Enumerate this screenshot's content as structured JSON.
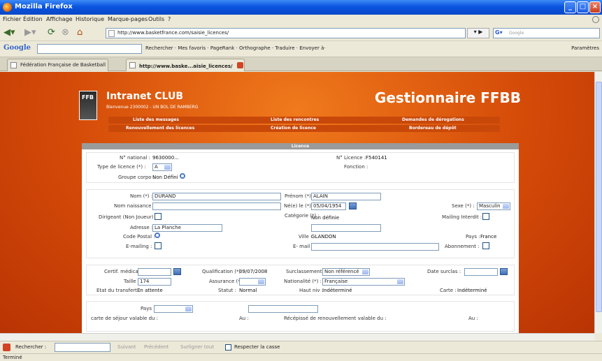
{
  "window": {
    "title": "Mozilla Firefox"
  },
  "menu": [
    "Fichier",
    "Édition",
    "Affichage",
    "Historique",
    "Marque-pages",
    "Outils",
    "?"
  ],
  "nav": {
    "url": "http://www.basketfrance.com/saisie_licences/",
    "search_placeholder": "Google"
  },
  "googlebar": {
    "logo": "Google",
    "tools": "Rechercher · Mes favoris · PageRank · Orthographe · Traduire · Envoyer à·",
    "params": "Paramètres"
  },
  "tabs": [
    {
      "label": "Fédération Française de Basketball"
    },
    {
      "label": "http://www.baske...aisie_licences/"
    }
  ],
  "header": {
    "logo_text": "FFB",
    "club": "Intranet CLUB",
    "welcome": "Bienvenue 2300002 - UN BOL DE RAMBERG",
    "gestionnaire": "Gestionnaire FFBB",
    "nav1": [
      "Liste des messages",
      "Liste des rencontres",
      "Demandes de dérogations"
    ],
    "nav2": [
      "Renouvellement des licences",
      "Création de licence",
      "Bordereau de dépôt"
    ]
  },
  "panel": {
    "strip": "Licence"
  },
  "sec1": {
    "num_national_label": "N° national :",
    "num_national": "9630000...",
    "type_licence_label": "Type de licence (*) :",
    "type_licence": "A",
    "groupe_label": "Groupe corpo :",
    "groupe": "Non Défini",
    "num_licence_label": "N° Licence :",
    "num_licence": "F540141",
    "fonction_label": "Fonction :"
  },
  "sec2": {
    "nom_label": "Nom (*) :",
    "nom": "DURAND",
    "naissance_label": "Nom naissance :",
    "prenom_label": "Prénom (*) :",
    "prenom": "ALAIN",
    "nele_label": "Né(e) le (*) :",
    "nele": "05/04/1954",
    "sexe_label": "Sexe (*) :",
    "sexe": "Masculin",
    "dirigeant_label": "Dirigeant (Non Joueur) :",
    "categorie_label": "Catégorie (*) :",
    "categorie": "Non définie",
    "mailing_label": "Mailing Interdit :",
    "adresse_label": "Adresse :",
    "adresse": "La Planche",
    "cp_label": "Code Postal :",
    "ville_label": "Ville :",
    "ville": "GLANDON",
    "pays_label": "Pays :",
    "pays": "France",
    "emailing_label": "E-mailing :",
    "email_label": "E- mail :",
    "abonnement_label": "Abonnement :"
  },
  "sec3": {
    "certif_label": "Certif. médical :",
    "qualif_label": "Qualification (*) :",
    "qualif": "09/07/2008",
    "surclass_label": "Surclassement :",
    "surclass": "Non référencé",
    "date_surclass_label": "Date surclas :",
    "taille_label": "Taille :",
    "taille": "174",
    "assurance_label": "Assurance (*) :",
    "nationalite_label": "Nationalité (*) :",
    "nationalite": "Française",
    "etat_label": "Etat du transfert :",
    "etat": "En attente",
    "statut_label": "Statut :",
    "statut": "Normal",
    "hautniv_label": "Haut niv :",
    "hautniv": "Indéterminé",
    "carte_label": "Carte :",
    "carte": "Indéterminé"
  },
  "sec4": {
    "pays_label": "Pays :",
    "carte_sejour_label": "carte de séjour valable du :",
    "au_label": "Au :",
    "recepisse_label": "Récépissé de renouvellement valable du :",
    "au2_label": "Au :"
  },
  "findbar": {
    "label": "Rechercher :",
    "suivant": "Suivant",
    "precedent": "Précédent",
    "surligner": "Surligner tout",
    "casse": "Respecter la casse"
  },
  "status": "Terminé"
}
